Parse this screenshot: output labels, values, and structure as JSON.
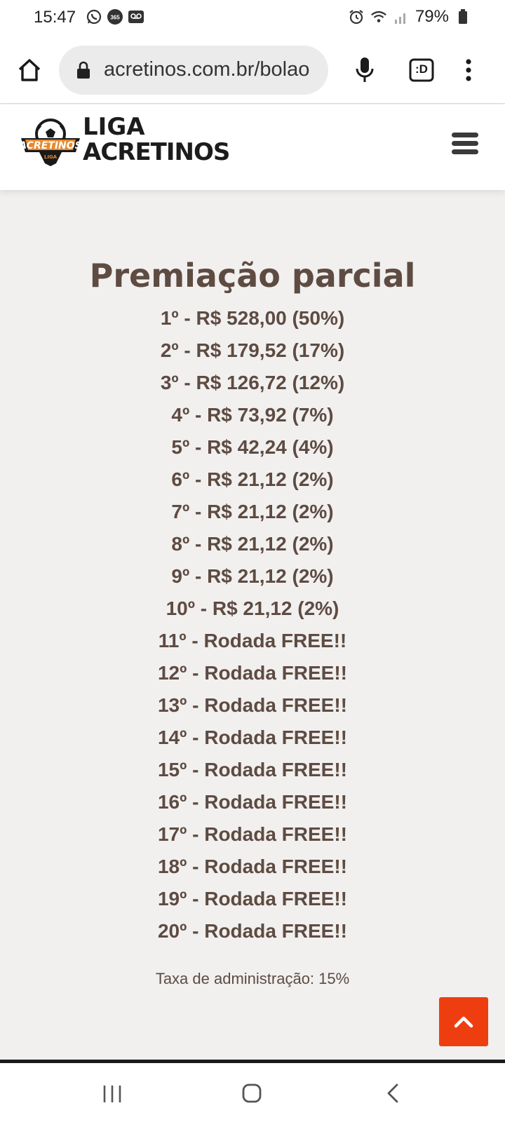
{
  "status_bar": {
    "time": "15:47",
    "battery": "79%",
    "notification_icons": [
      "whatsapp-icon",
      "app-365-icon",
      "voicemail-icon"
    ],
    "system_icons": [
      "alarm-icon",
      "wifi-icon",
      "signal-icon",
      "battery-icon"
    ]
  },
  "browser": {
    "url": "acretinos.com.br/bolao",
    "tab_count": ":D"
  },
  "site": {
    "logo_line1": "LIGA",
    "logo_line2": "ACRETINOS",
    "badge_text": "ACRETINOS",
    "badge_sub": "LIGA"
  },
  "main": {
    "title": "Premiação parcial",
    "prizes": [
      "1º - R$ 528,00 (50%)",
      "2º - R$ 179,52 (17%)",
      "3º - R$ 126,72 (12%)",
      "4º - R$ 73,92 (7%)",
      "5º - R$ 42,24 (4%)",
      "6º - R$ 21,12 (2%)",
      "7º - R$ 21,12 (2%)",
      "8º - R$ 21,12 (2%)",
      "9º - R$ 21,12 (2%)",
      "10º - R$ 21,12 (2%)",
      "11º - Rodada FREE!!",
      "12º - Rodada FREE!!",
      "13º - Rodada FREE!!",
      "14º - Rodada FREE!!",
      "15º - Rodada FREE!!",
      "16º - Rodada FREE!!",
      "17º - Rodada FREE!!",
      "18º - Rodada FREE!!",
      "19º - Rodada FREE!!",
      "20º - Rodada FREE!!"
    ],
    "admin_fee": "Taxa de administração: 15%"
  },
  "colors": {
    "text_brown": "#5e4b42",
    "background": "#f1f0ef",
    "accent_orange": "#ee3e10"
  }
}
